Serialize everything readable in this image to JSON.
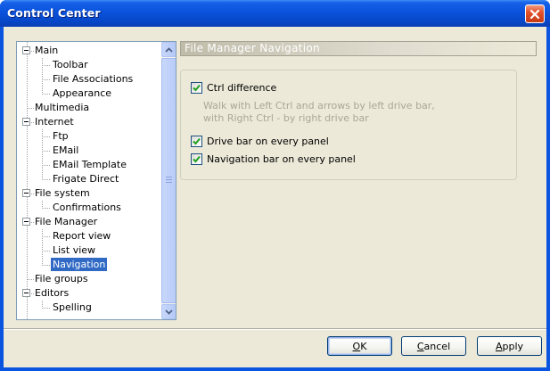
{
  "window": {
    "title": "Control Center"
  },
  "tree": {
    "items": [
      {
        "label": "Main",
        "level": 0,
        "expanded": true
      },
      {
        "label": "Toolbar",
        "level": 1
      },
      {
        "label": "File Associations",
        "level": 1
      },
      {
        "label": "Appearance",
        "level": 1
      },
      {
        "label": "Multimedia",
        "level": 0
      },
      {
        "label": "Internet",
        "level": 0,
        "expanded": true
      },
      {
        "label": "Ftp",
        "level": 1
      },
      {
        "label": "EMail",
        "level": 1
      },
      {
        "label": "EMail Template",
        "level": 1
      },
      {
        "label": "Frigate Direct",
        "level": 1
      },
      {
        "label": "File system",
        "level": 0,
        "expanded": true
      },
      {
        "label": "Confirmations",
        "level": 1
      },
      {
        "label": "File Manager",
        "level": 0,
        "expanded": true
      },
      {
        "label": "Report view",
        "level": 1
      },
      {
        "label": "List view",
        "level": 1
      },
      {
        "label": "Navigation",
        "level": 1,
        "selected": true
      },
      {
        "label": "File groups",
        "level": 0
      },
      {
        "label": "Editors",
        "level": 0,
        "expanded": true
      },
      {
        "label": "Spelling",
        "level": 1
      }
    ]
  },
  "panel": {
    "title": "File Manager Navigation",
    "ctrl_difference": {
      "label": "Ctrl difference",
      "checked": true
    },
    "hint_line1": "Walk with Left Ctrl and arrows by left drive bar,",
    "hint_line2": "with Right Ctrl - by right drive bar",
    "drive_bar": {
      "label": "Drive bar on every panel",
      "checked": true
    },
    "nav_bar": {
      "label": "Navigation bar on every panel",
      "checked": true
    }
  },
  "buttons": {
    "ok": {
      "hotkey": "O",
      "rest": "K"
    },
    "cancel": {
      "hotkey": "C",
      "rest": "ancel"
    },
    "apply": {
      "hotkey": "A",
      "rest": "pply"
    }
  },
  "colors": {
    "titlebar": "#0a52dc",
    "selection": "#316ac5",
    "face": "#ece9d8",
    "check": "#21a121"
  }
}
